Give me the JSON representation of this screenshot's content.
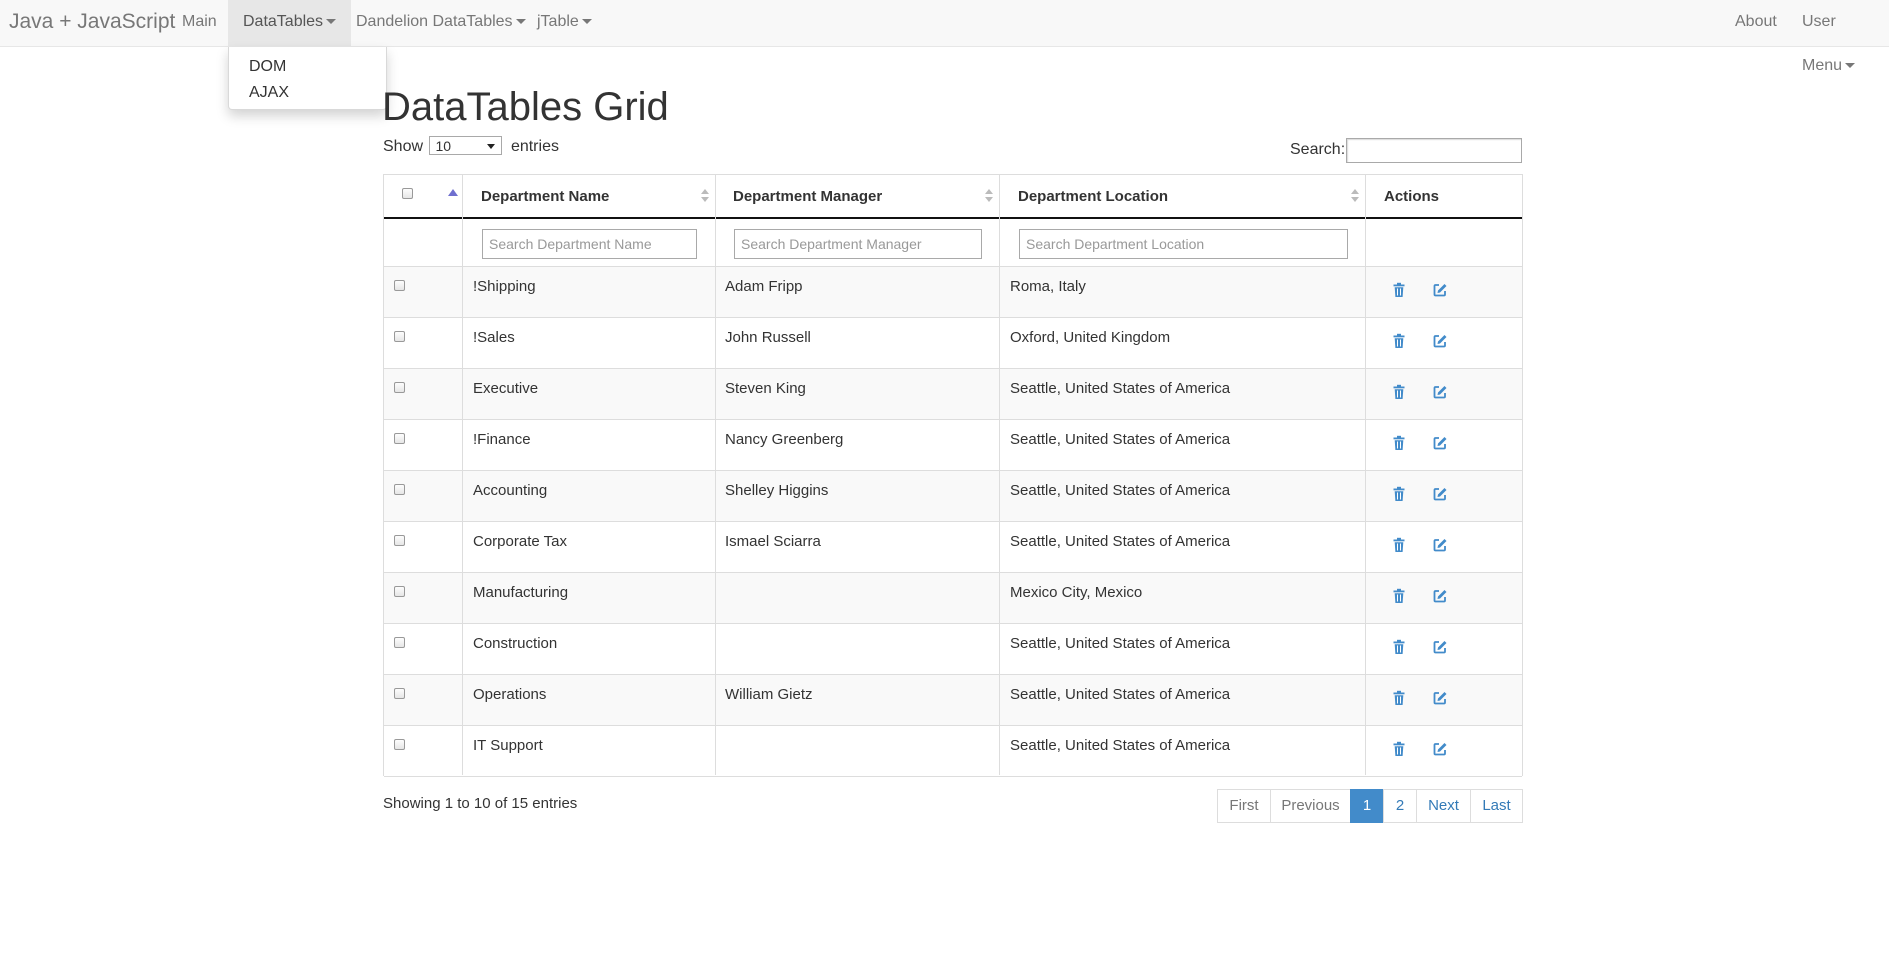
{
  "navbar": {
    "brand": "Java + JavaScript",
    "items": [
      {
        "label": "Main"
      },
      {
        "label": "DataTables"
      },
      {
        "label": "Dandelion DataTables"
      },
      {
        "label": "jTable"
      }
    ],
    "right": [
      {
        "label": "About"
      },
      {
        "label": "User Menu"
      }
    ]
  },
  "dropdown": {
    "items": [
      {
        "label": "DOM"
      },
      {
        "label": "AJAX"
      }
    ]
  },
  "page": {
    "title": "DataTables Grid",
    "length": {
      "show": "Show",
      "value": "10",
      "entries": "entries"
    },
    "search_label": "Search:"
  },
  "table": {
    "columns": [
      {
        "label": "Department Name",
        "filter_placeholder": "Search Department Name"
      },
      {
        "label": "Department Manager",
        "filter_placeholder": "Search Department Manager"
      },
      {
        "label": "Department Location",
        "filter_placeholder": "Search Department Location"
      },
      {
        "label": "Actions"
      }
    ],
    "rows": [
      {
        "name": "!Shipping",
        "manager": "Adam Fripp",
        "location": "Roma, Italy"
      },
      {
        "name": "!Sales",
        "manager": "John Russell",
        "location": "Oxford, United Kingdom"
      },
      {
        "name": "Executive",
        "manager": "Steven King",
        "location": "Seattle, United States of America"
      },
      {
        "name": "!Finance",
        "manager": "Nancy Greenberg",
        "location": "Seattle, United States of America"
      },
      {
        "name": "Accounting",
        "manager": "Shelley Higgins",
        "location": "Seattle, United States of America"
      },
      {
        "name": "Corporate Tax",
        "manager": "Ismael Sciarra",
        "location": "Seattle, United States of America"
      },
      {
        "name": "Manufacturing",
        "manager": "",
        "location": "Mexico City, Mexico"
      },
      {
        "name": "Construction",
        "manager": "",
        "location": "Seattle, United States of America"
      },
      {
        "name": "Operations",
        "manager": "William Gietz",
        "location": "Seattle, United States of America"
      },
      {
        "name": "IT Support",
        "manager": "",
        "location": "Seattle, United States of America"
      }
    ]
  },
  "footer": {
    "info": "Showing 1 to 10 of 15 entries",
    "pagination": [
      {
        "label": "First"
      },
      {
        "label": "Previous"
      },
      {
        "label": "1"
      },
      {
        "label": "2"
      },
      {
        "label": "Next"
      },
      {
        "label": "Last"
      }
    ]
  },
  "colors": {
    "accent": "#428bca",
    "link": "#337ab7",
    "icon": "#428bca"
  },
  "icons": {
    "delete": "trash-icon",
    "edit": "edit-icon"
  }
}
